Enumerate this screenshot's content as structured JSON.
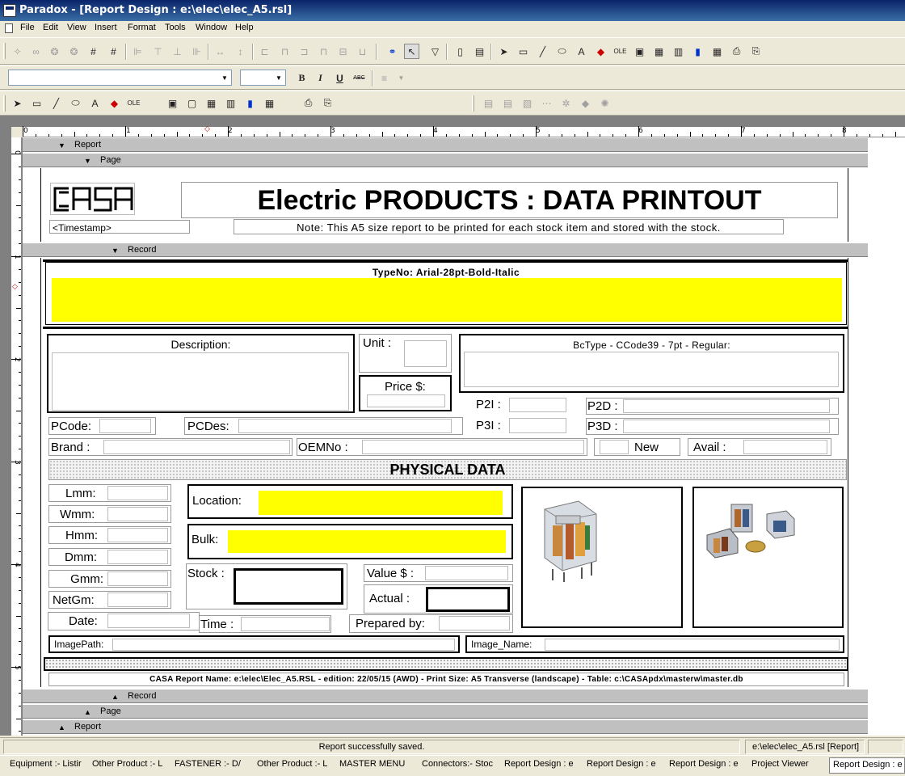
{
  "window": {
    "title": "Paradox - [Report Design : e:\\elec\\elec_A5.rsl]"
  },
  "menu": [
    "File",
    "Edit",
    "View",
    "Insert",
    "Format",
    "Tools",
    "Window",
    "Help"
  ],
  "format_toolbar": {
    "font_name": "",
    "font_size": "",
    "bold": "B",
    "italic": "I",
    "underline": "U",
    "strikeout": "ABC"
  },
  "ruler": {
    "h_numbers": [
      "0",
      "1",
      "2",
      "3",
      "4",
      "5",
      "6",
      "7",
      "8"
    ],
    "v_numbers": [
      "0",
      "1",
      "2",
      "3",
      "4",
      "5"
    ]
  },
  "bands": {
    "report_header": "Report",
    "page_header": "Page",
    "record_header": "Record",
    "record_footer": "Record",
    "page_footer": "Page",
    "report_footer": "Report"
  },
  "header": {
    "logo_text": "CASA",
    "timestamp": "<Timestamp>",
    "title": "Electric PRODUCTS : DATA PRINTOUT",
    "note": "Note: This A5 size report to be printed for each stock item and stored with the stock."
  },
  "record": {
    "typeno_label": "TypeNo: Arial-28pt-Bold-Italic",
    "description_label": "Description:",
    "unit_label": "Unit :",
    "price_label": "Price $:",
    "bctype_label": "BcType - CCode39 - 7pt - Regular:",
    "p2i_label": "P2I :",
    "p2d_label": "P2D :",
    "p3i_label": "P3I :",
    "p3d_label": "P3D :",
    "pcode_label": "PCode:",
    "pcdes_label": "PCDes:",
    "brand_label": "Brand :",
    "oemno_label": "OEMNo :",
    "new_label": "New",
    "avail_label": "Avail :",
    "physical_title": "PHYSICAL DATA",
    "lmm_label": "Lmm:",
    "wmm_label": "Wmm:",
    "hmm_label": "Hmm:",
    "dmm_label": "Dmm:",
    "gmm_label": "Gmm:",
    "netgm_label": "NetGm:",
    "date_label": "Date:",
    "location_label": "Location:",
    "bulk_label": "Bulk:",
    "stock_label": "Stock :",
    "value_label": "Value $ :",
    "actual_label": "Actual :",
    "time_label": "Time :",
    "prepared_label": "Prepared by:",
    "imagepath_label": "ImagePath:",
    "imagename_label": "Image_Name:",
    "footer_text": "CASA Report Name: e:\\elec\\Elec_A5.RSL - edition: 22/05/15 (AWD) - Print Size: A5 Transverse (landscape) - Table: c:\\CASApdx\\masterw\\master.db"
  },
  "statusbar": {
    "message": "Report successfully saved.",
    "file": "e:\\elec\\elec_A5.rsl [Report]"
  },
  "taskbar": [
    "Equipment :- Listir",
    "Other Product :- L",
    "FASTENER :- D/",
    "Other Product :- L",
    "MASTER MENU",
    "Connectors:- Stoc",
    "Report Design : e",
    "Report Design : e",
    "Report Design : e",
    "Project Viewer",
    "Report Design : e"
  ],
  "colors": {
    "title_bar": "#0a246a",
    "highlight_field": "#ffff00",
    "band": "#c0c0c0",
    "design_bg": "#808080"
  },
  "icons": {
    "toolbar1": [
      "wand-icon",
      "link-icon",
      "group-icon",
      "group2-icon",
      "grid-icon",
      "grid-snap-icon",
      "align-left-icon",
      "align-top-icon",
      "align-bottom-icon",
      "align-right-icon",
      "space-h-icon",
      "space-v-icon",
      "align-left2-icon",
      "align-center-icon",
      "align-right2-icon",
      "align-top2-icon",
      "align-middle-icon",
      "align-bottom2-icon",
      "data-model-icon",
      "select-tool-icon",
      "filter-icon",
      "page-icon",
      "record-layout-icon",
      "pointer-icon",
      "box-tool-icon",
      "line-tool-icon",
      "ellipse-tool-icon",
      "text-tool-icon",
      "graphic-tool-icon",
      "ole-tool-icon",
      "field-tool-icon",
      "table-tool-icon",
      "multirecord-tool-icon",
      "chart-tool-icon",
      "crosstab-tool-icon",
      "print-icon",
      "preview-icon"
    ]
  }
}
